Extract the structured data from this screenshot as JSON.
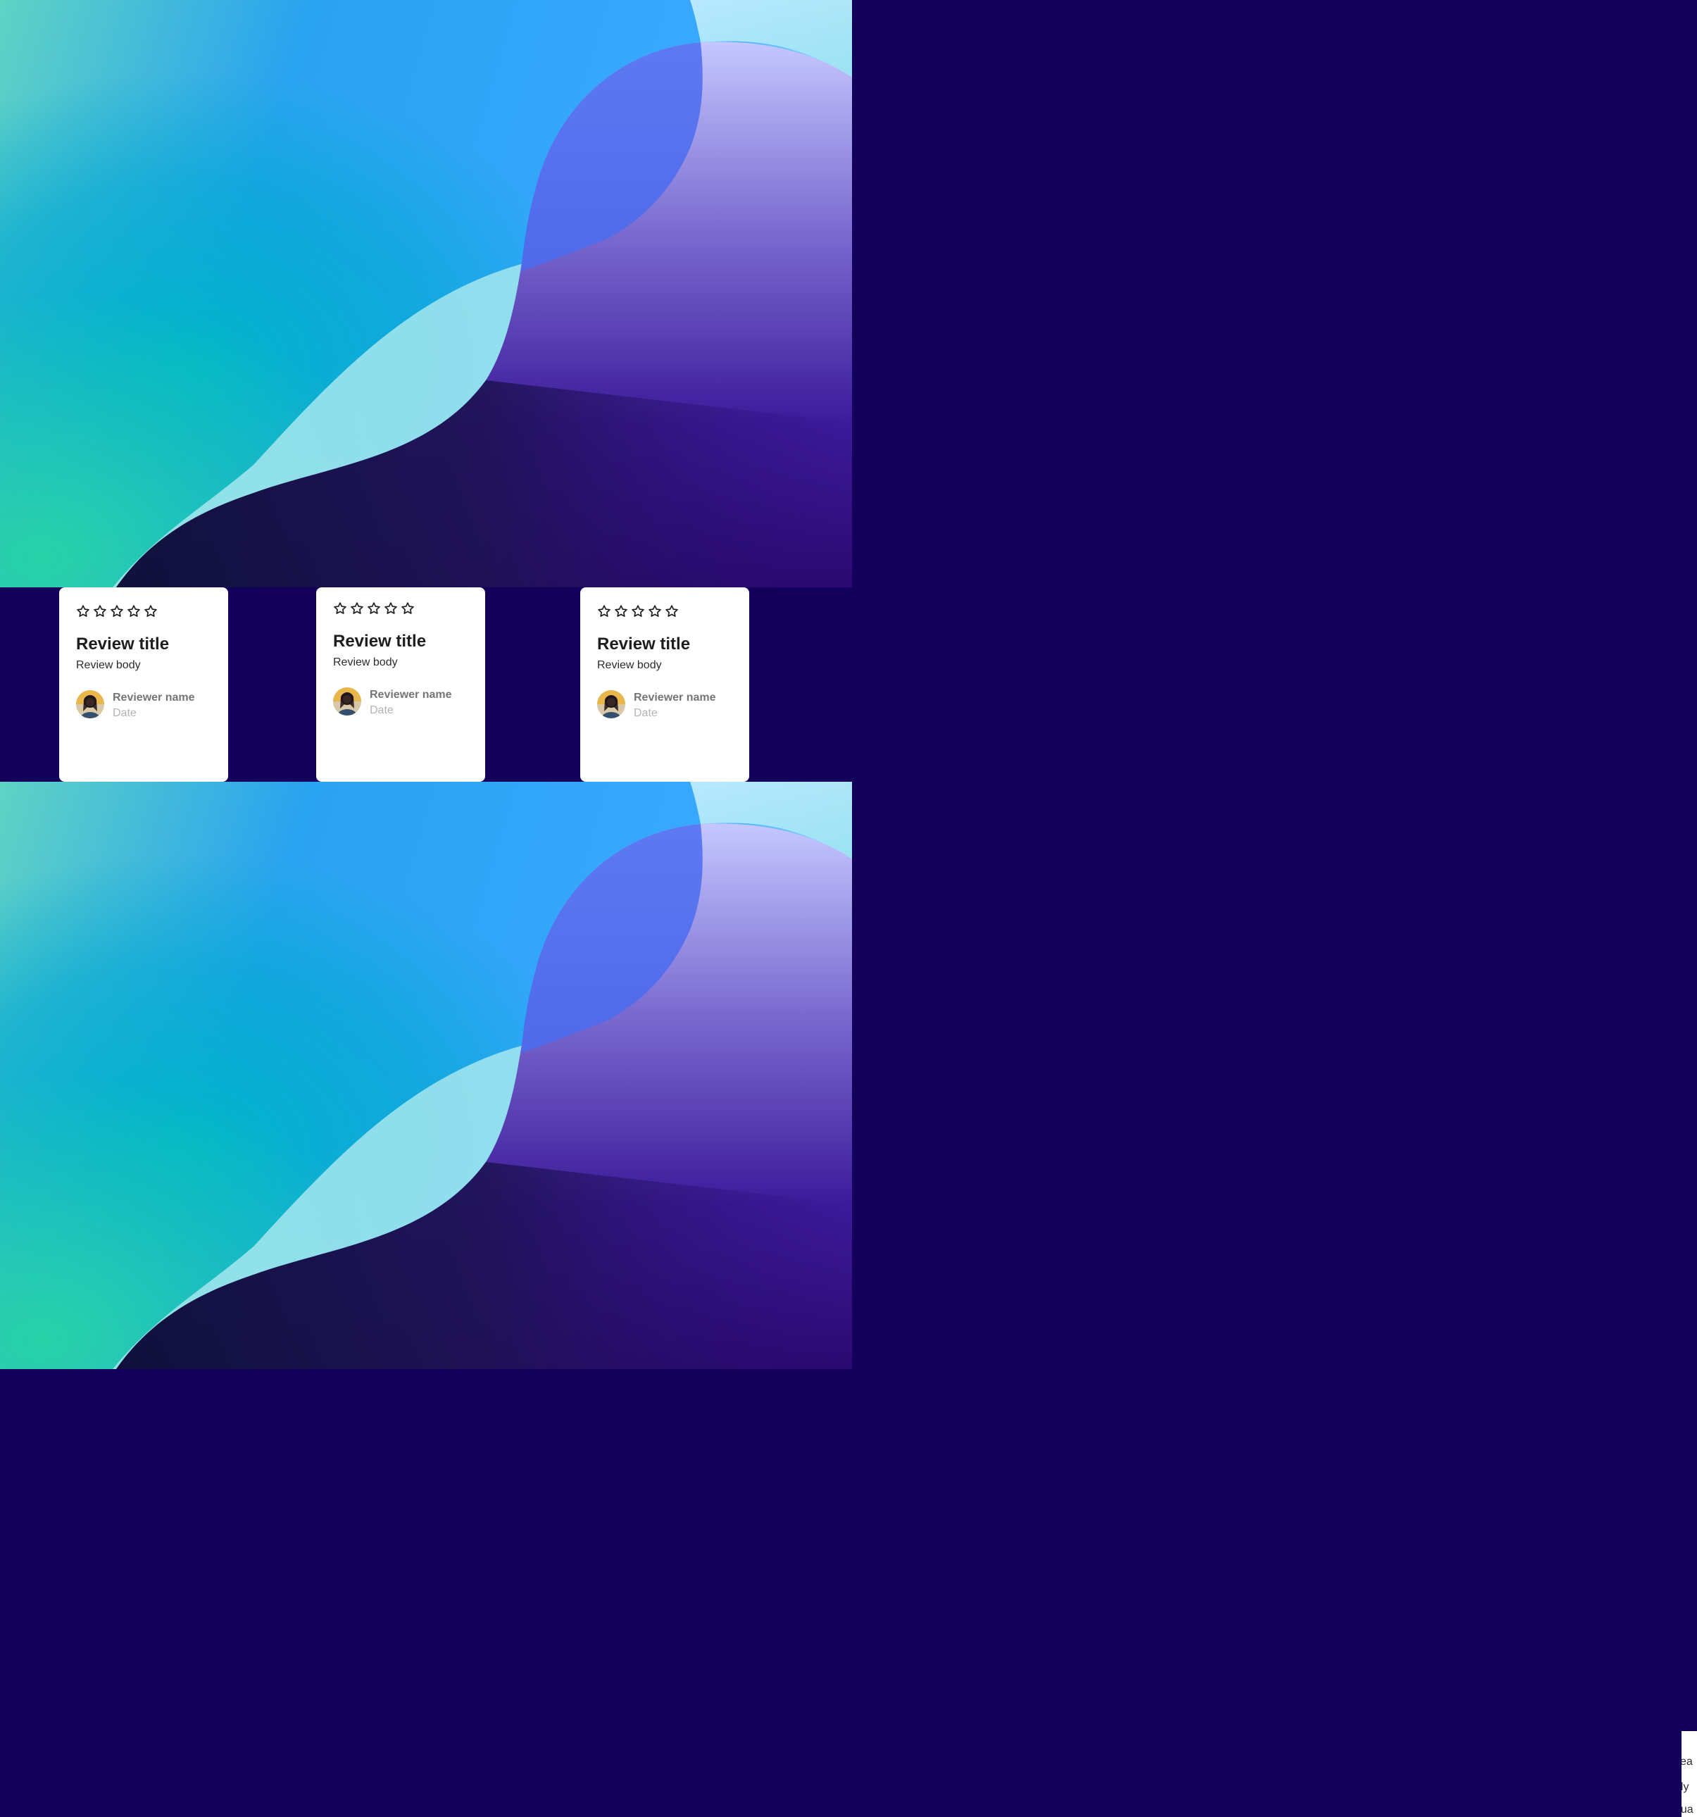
{
  "page": {
    "background_color": "#12005a"
  },
  "hero": {
    "colors": [
      "#60e0c8",
      "#2e9bff",
      "#b8e6ff",
      "#c8c8ff",
      "#2a0a7a",
      "#0a1030"
    ]
  },
  "reviews": [
    {
      "rating": 0,
      "max_rating": 5,
      "title": "Review title",
      "body": "Review body",
      "reviewer_name": "Reviewer name",
      "date": "Date",
      "avatar_icon": "reviewer-avatar"
    },
    {
      "rating": 0,
      "max_rating": 5,
      "title": "Review title",
      "body": "Review body",
      "reviewer_name": "Reviewer name",
      "date": "Date",
      "avatar_icon": "reviewer-avatar"
    },
    {
      "rating": 0,
      "max_rating": 5,
      "title": "Review title",
      "body": "Review body",
      "reviewer_name": "Reviewer name",
      "date": "Date",
      "avatar_icon": "reviewer-avatar"
    }
  ],
  "peek": {
    "lines": [
      "cea",
      "uly",
      "oua"
    ]
  },
  "icons": {
    "star": "star-outline-icon"
  }
}
